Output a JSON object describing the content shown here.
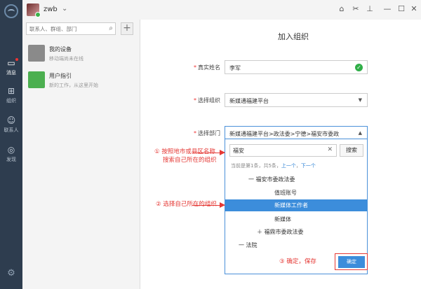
{
  "app": {
    "username": "zwb"
  },
  "nav": [
    {
      "label": "消息",
      "icon": "chat-icon"
    },
    {
      "label": "组织",
      "icon": "org-icon"
    },
    {
      "label": "联系人",
      "icon": "contacts-icon"
    },
    {
      "label": "发现",
      "icon": "discover-icon"
    }
  ],
  "sidebar": {
    "search_placeholder": "联系人、群组、部门",
    "items": [
      {
        "title": "我的设备",
        "subtitle": "移动端尚未在线"
      },
      {
        "title": "用户指引",
        "subtitle": "新的工作，从这里开始"
      }
    ]
  },
  "form": {
    "title": "加入组织",
    "name_label": "真实姓名",
    "name_value": "李军",
    "org_label": "选择组织",
    "org_value": "新媒通福建平台",
    "dept_label": "选择部门",
    "dept_value": "新媒通福建平台>政法委>宁德>福安市委政"
  },
  "dropdown": {
    "search_value": "福安",
    "search_button": "搜索",
    "pager_prefix": "当前是第1条，共5条，",
    "prev": "上一个",
    "next": "下一个",
    "tree": [
      "一 福安市委政法委",
      "值班账号",
      "新媒体工作者",
      "新媒体",
      "＋ 福鼎市委政法委",
      "一 法院"
    ],
    "confirm": "确定"
  },
  "annotations": {
    "a1_line1": "① 按照地市或县区名称",
    "a1_line2": "搜索自己所在的组织",
    "a2": "② 选择自己所在的组织",
    "a3": "③ 确定，保存"
  },
  "colors": {
    "nav_bg": "#2e3d4f",
    "accent": "#3c8ddb",
    "annotation": "#e53935"
  }
}
